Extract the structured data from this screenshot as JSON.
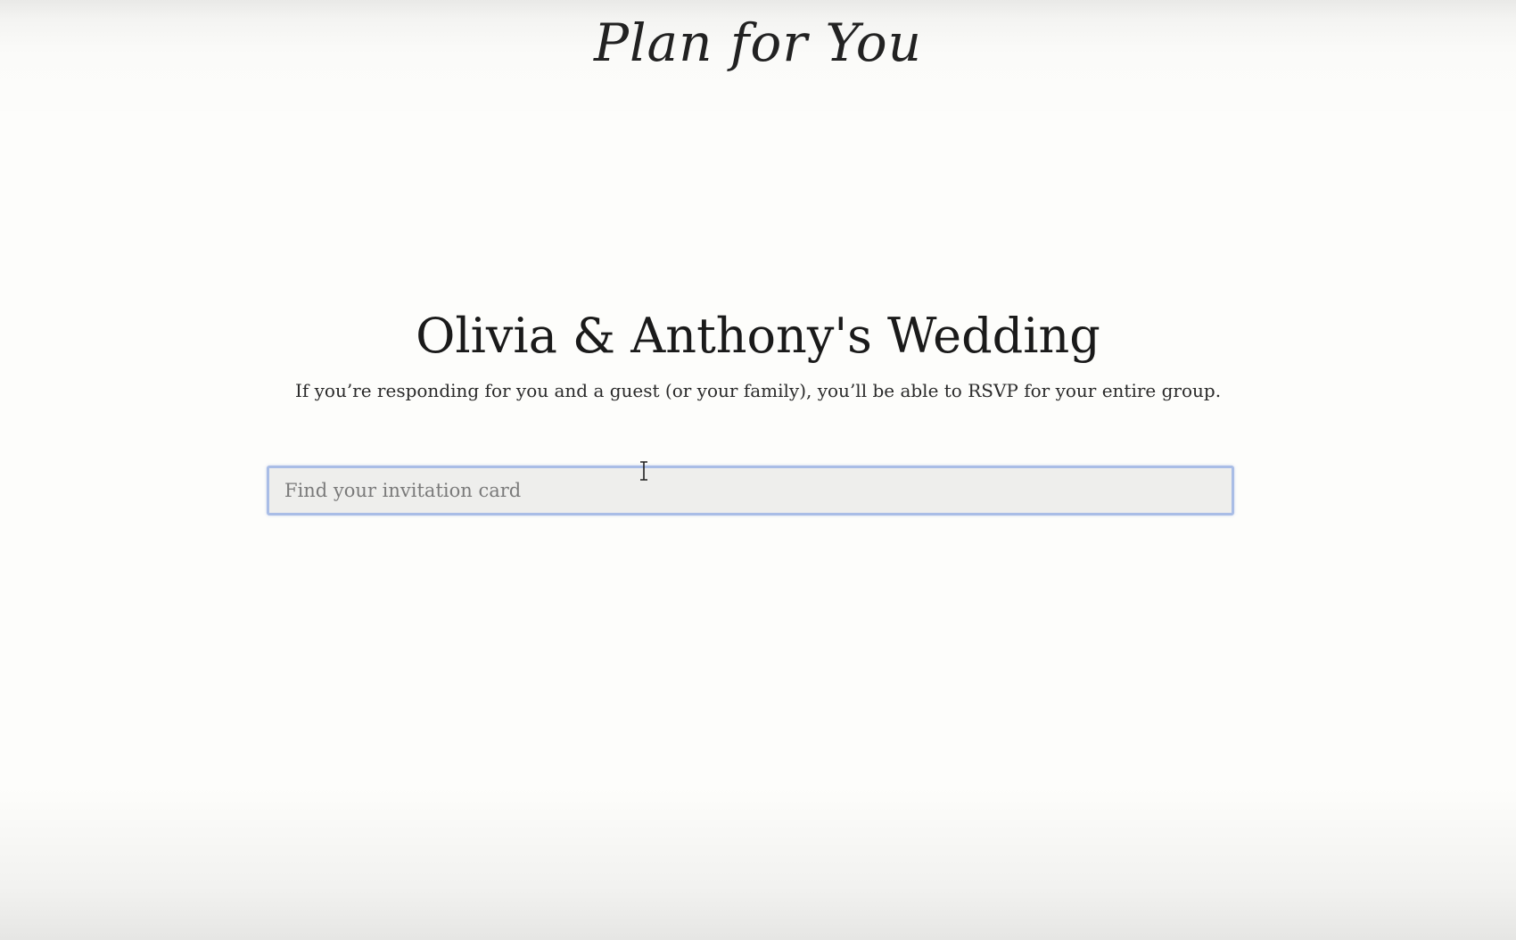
{
  "header": {
    "logo_text": "Plan for You"
  },
  "main": {
    "title": "Olivia & Anthony's Wedding",
    "subtitle": "If you’re responding for you and a guest (or your family), you’ll be able to RSVP for your entire group.",
    "search": {
      "placeholder": "Find your invitation card",
      "value": ""
    }
  },
  "colors": {
    "background": "#fdfdfb",
    "input_focus_border": "#a9bde6",
    "input_background": "#eeeeec"
  },
  "icons": {
    "mouse_cursor": "text-cursor-icon"
  }
}
